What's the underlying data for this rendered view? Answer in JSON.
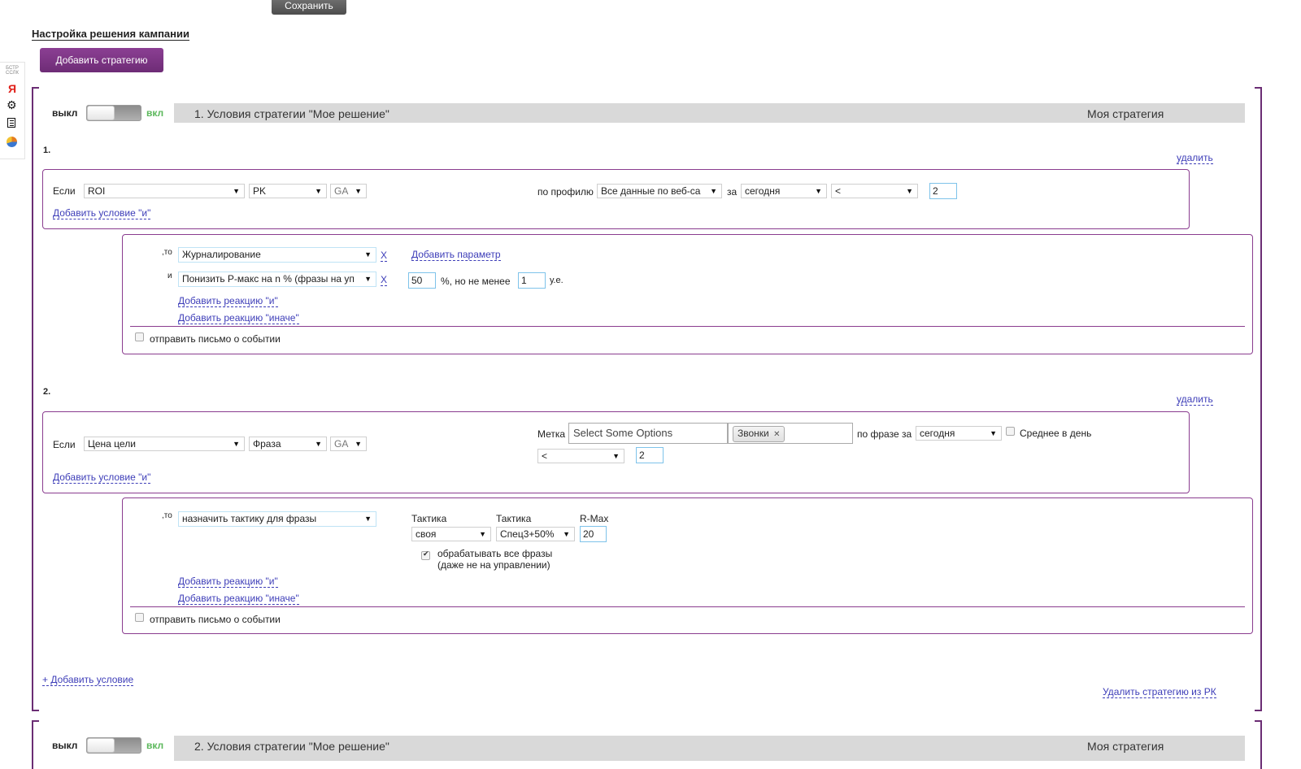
{
  "toolbar": {
    "save_label": "Сохранить"
  },
  "page_title": "Настройка решения кампании",
  "add_strategy_label": "Добавить стратегию",
  "side": {
    "quicklinks_label": "БСТР ССЛК",
    "yandex_label": "Я"
  },
  "strategy1": {
    "off_label": "выкл",
    "on_label": "вкл",
    "title": "1. Условия стратегии \"Мое решение\"",
    "name": "Моя стратегия",
    "cond1": {
      "num": "1.",
      "delete_label": "удалить",
      "if_label": "Если",
      "metric": "ROI",
      "level": "PK",
      "source": "GA",
      "profile_label": "по профилю",
      "profile": "Все данные по веб-са",
      "period_label": "за",
      "period": "сегодня",
      "op": "<",
      "value": "2",
      "add_and_label": "Добавить условие \"и\"",
      "then_label": ",то",
      "and_label": "и",
      "action1": "Журналирование",
      "x1": "X",
      "add_param_label": "Добавить параметр",
      "action2": "Понизить Р-макс на n % (фразы на уп",
      "x2": "X",
      "percent_value": "50",
      "percent_text": "%, но не менее",
      "min_value": "1",
      "unit": "у.е.",
      "add_reaction_and": "Добавить реакцию \"и\"",
      "add_reaction_else": "Добавить реакцию \"иначе\"",
      "email_label": "отправить письмо о событии"
    },
    "cond2": {
      "num": "2.",
      "delete_label": "удалить",
      "if_label": "Если",
      "metric": "Цена цели",
      "level": "Фраза",
      "source": "GA",
      "tag_label": "Метка",
      "tag_placeholder": "Select Some Options",
      "tag_chip": "Звонки",
      "tag_chip_x": "✕",
      "phrase_period_label": "по фразе за",
      "period": "сегодня",
      "avg_label": "Среднее в день",
      "op": "<",
      "value": "2",
      "add_and_label": "Добавить условие \"и\"",
      "then_label": ",то",
      "action": "назначить тактику для фразы",
      "tactic_label_1": "Тактика",
      "tactic_value_1": "своя",
      "tactic_label_2": "Тактика",
      "tactic_value_2": "Спец3+50%",
      "rmax_label": "R-Max",
      "rmax_value": "20",
      "process_all_line1": "обрабатывать все фразы",
      "process_all_line2": "(даже не на управлении)",
      "add_reaction_and": "Добавить реакцию \"и\"",
      "add_reaction_else": "Добавить реакцию \"иначе\"",
      "email_label": "отправить письмо о событии"
    },
    "add_condition_label": "+ Добавить условие",
    "delete_strategy_label": "Удалить стратегию из РК"
  },
  "strategy2": {
    "off_label": "выкл",
    "on_label": "вкл",
    "title": "2. Условия стратегии \"Мое решение\"",
    "name": "Моя стратегия"
  },
  "colors": {
    "accent": "#7b3a82",
    "border": "#8a3c8f",
    "link": "#3d3db8",
    "on_green": "#4caf50"
  },
  "icons": [
    "yandex-icon",
    "gear-icon",
    "list-icon",
    "chart-pie-icon"
  ]
}
